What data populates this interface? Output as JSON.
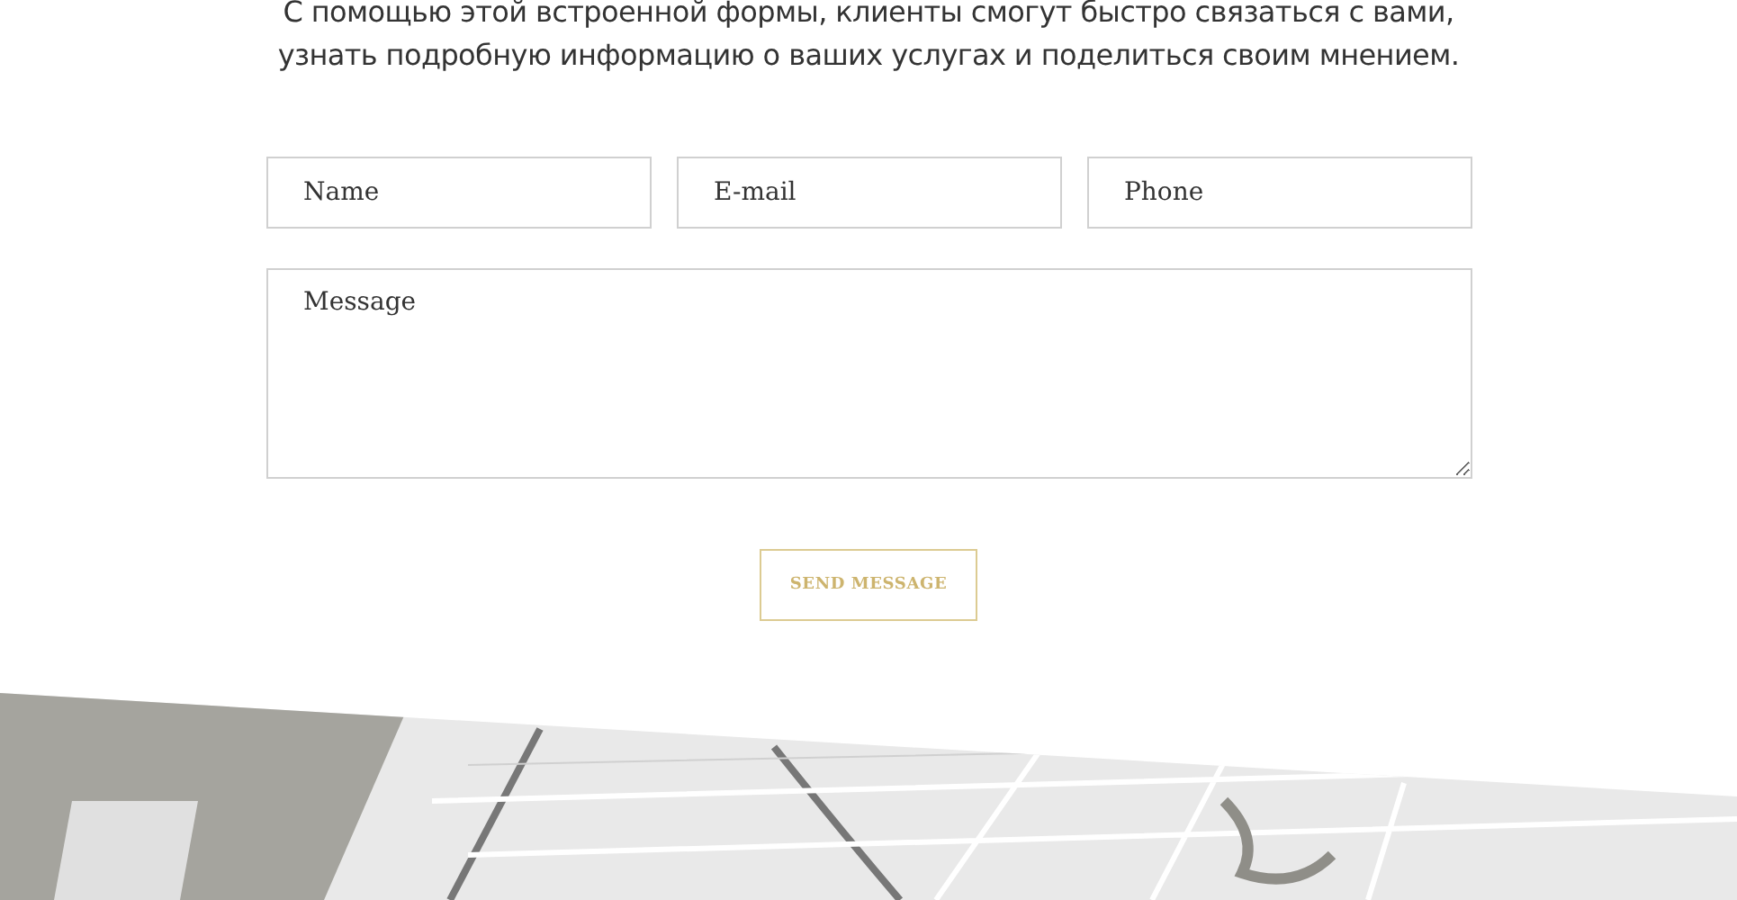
{
  "intro": "С помощью этой встроенной формы, клиенты смогут быстро связаться с вами, узнать подробную информацию о ваших услугах и поделиться своим мнением.",
  "fields": [
    {
      "placeholder": "Name"
    },
    {
      "placeholder": "E-mail"
    },
    {
      "placeholder": "Phone"
    }
  ],
  "message": {
    "placeholder": "Message"
  },
  "send_button": "SEND MESSAGE"
}
